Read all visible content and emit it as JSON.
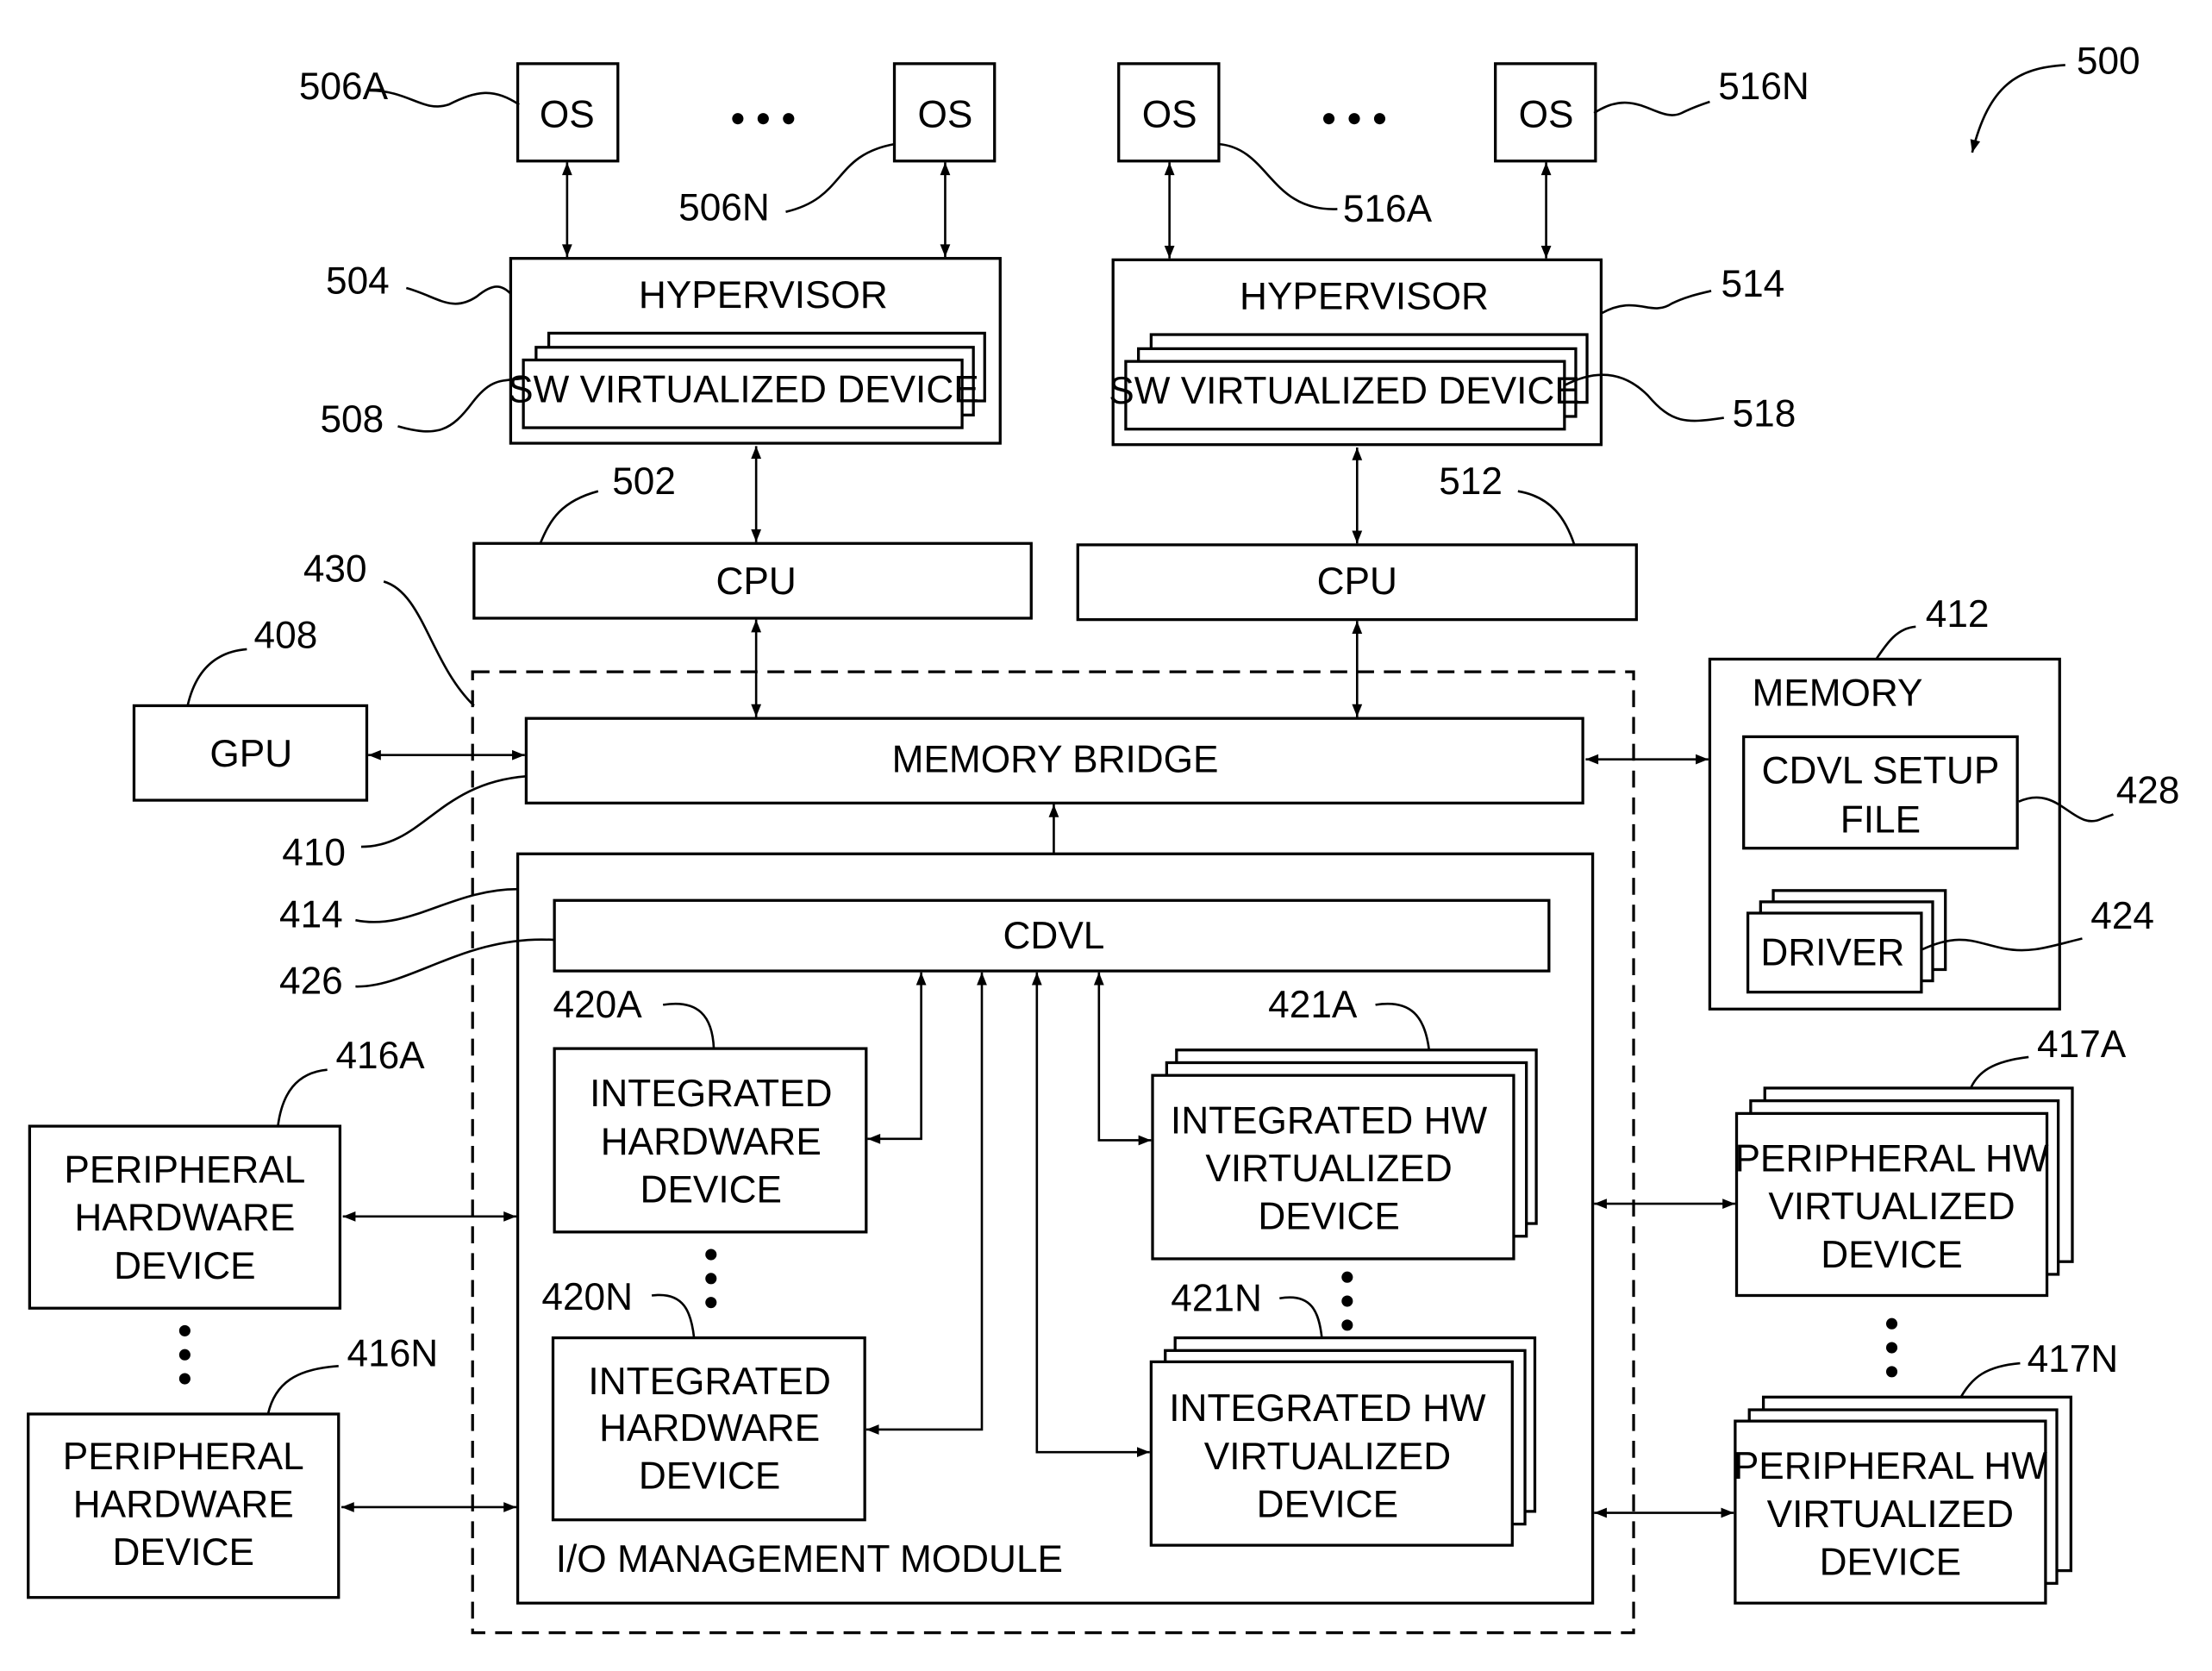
{
  "figure_number": "500",
  "nodes": {
    "os_506a": {
      "label": "OS",
      "ref": "506A"
    },
    "os_506n": {
      "label": "OS",
      "ref": "506N"
    },
    "os_516a": {
      "label": "OS",
      "ref": "516A"
    },
    "os_516n": {
      "label": "OS",
      "ref": "516N"
    },
    "hypervisor_504": {
      "label": "HYPERVISOR",
      "ref": "504"
    },
    "hypervisor_514": {
      "label": "HYPERVISOR",
      "ref": "514"
    },
    "sw_virt_508": {
      "label": "SW VIRTUALIZED DEVICE",
      "ref": "508"
    },
    "sw_virt_518": {
      "label": "SW VIRTUALIZED DEVICE",
      "ref": "518"
    },
    "cpu_502": {
      "label": "CPU",
      "ref": "502"
    },
    "cpu_512": {
      "label": "CPU",
      "ref": "512"
    },
    "gpu_408": {
      "label": "GPU",
      "ref": "408"
    },
    "memory_bridge_410": {
      "label": "MEMORY BRIDGE",
      "ref": "410"
    },
    "chipset_430": {
      "ref": "430"
    },
    "memory_412": {
      "label": "MEMORY",
      "ref": "412"
    },
    "cdvl_setup_428": {
      "label_line1": "CDVL SETUP",
      "label_line2": "FILE",
      "ref": "428"
    },
    "driver_424": {
      "label": "DRIVER",
      "ref": "424"
    },
    "io_module_414": {
      "label": "I/O MANAGEMENT MODULE",
      "ref": "414"
    },
    "cdvl_426": {
      "label": "CDVL",
      "ref": "426"
    },
    "ihd_420a": {
      "lines": [
        "INTEGRATED",
        "HARDWARE",
        "DEVICE"
      ],
      "ref": "420A"
    },
    "ihd_420n": {
      "lines": [
        "INTEGRATED",
        "HARDWARE",
        "DEVICE"
      ],
      "ref": "420N"
    },
    "ihvd_421a": {
      "lines": [
        "INTEGRATED HW",
        "VIRTUALIZED",
        "DEVICE"
      ],
      "ref": "421A"
    },
    "ihvd_421n": {
      "lines": [
        "INTEGRATED HW",
        "VIRTUALIZED",
        "DEVICE"
      ],
      "ref": "421N"
    },
    "phd_416a": {
      "lines": [
        "PERIPHERAL",
        "HARDWARE",
        "DEVICE"
      ],
      "ref": "416A"
    },
    "phd_416n": {
      "lines": [
        "PERIPHERAL",
        "HARDWARE",
        "DEVICE"
      ],
      "ref": "416N"
    },
    "phvd_417a": {
      "lines": [
        "PERIPHERAL HW",
        "VIRTUALIZED",
        "DEVICE"
      ],
      "ref": "417A"
    },
    "phvd_417n": {
      "lines": [
        "PERIPHERAL HW",
        "VIRTUALIZED",
        "DEVICE"
      ],
      "ref": "417N"
    }
  }
}
